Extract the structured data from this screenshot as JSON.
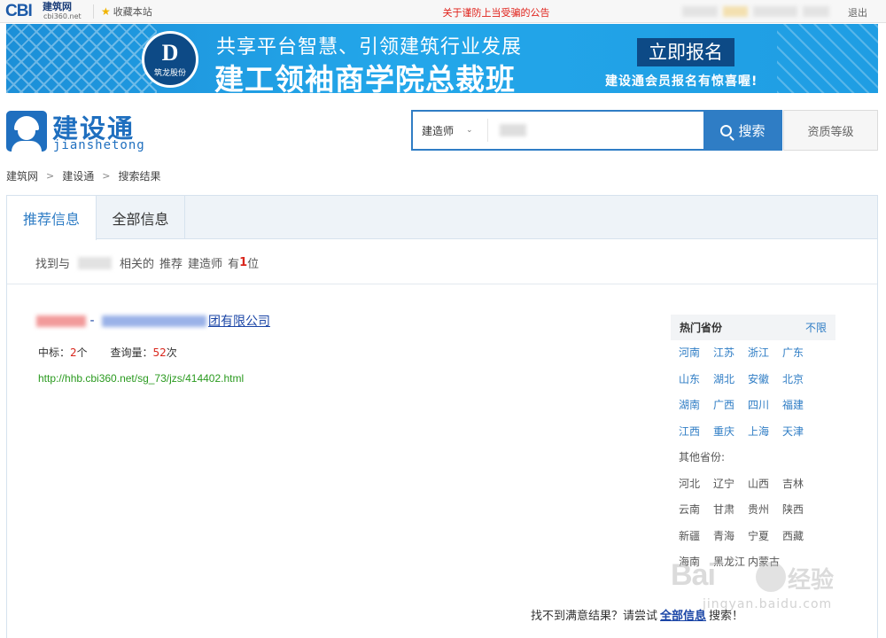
{
  "topbar": {
    "logo_text": "CBI",
    "logo_cn": "建筑网",
    "logo_domain": "cbi360.net",
    "favorite_label": "收藏本站",
    "notice": "关于谨防上当受骗的公告",
    "logout_label": "退出"
  },
  "banner": {
    "badge_brand": "筑龙股份",
    "line1": "共享平台智慧、引领建筑行业发展",
    "line2": "建工领袖商学院总裁班",
    "signup_label": "立即报名",
    "promo": "建设通会员报名有惊喜喔!"
  },
  "site_logo": {
    "title": "建设通",
    "pinyin": "jianshetong"
  },
  "search": {
    "category": "建造师",
    "query_value": "",
    "button_label": "搜索",
    "qualification_label": "资质等级"
  },
  "breadcrumb": [
    "建筑网",
    "建设通",
    "搜索结果"
  ],
  "tabs": [
    {
      "label": "推荐信息",
      "active": true
    },
    {
      "label": "全部信息",
      "active": false
    }
  ],
  "summary": {
    "prefix": "找到与",
    "middle": "相关的",
    "word1": "推荐",
    "word2": "建造师",
    "has": "有",
    "count": "1",
    "unit": "位"
  },
  "result": {
    "sep": " - ",
    "title_tail": "团有限公司",
    "bid_label": "中标：",
    "bid_count": "2",
    "bid_unit": "个",
    "views_label": "查询量：",
    "views_count": "52",
    "views_unit": "次",
    "url": "http://hhb.cbi360.net/sg_73/jzs/414402.html"
  },
  "provinces": {
    "hot_label": "热门省份",
    "unlimited_label": "不限",
    "hot": [
      "河南",
      "江苏",
      "浙江",
      "广东",
      "山东",
      "湖北",
      "安徽",
      "北京",
      "湖南",
      "广西",
      "四川",
      "福建",
      "江西",
      "重庆",
      "上海",
      "天津"
    ],
    "other_label": "其他省份:",
    "other": [
      "河北",
      "辽宁",
      "山西",
      "吉林",
      "云南",
      "甘肃",
      "贵州",
      "陕西",
      "新疆",
      "青海",
      "宁夏",
      "西藏",
      "海南",
      "黑龙江",
      "内蒙古"
    ]
  },
  "footer": {
    "prefix": "找不到满意结果？请尝试",
    "link": "全部信息",
    "suffix": "搜索！"
  },
  "watermark": {
    "brand": "Bai",
    "brand_cn": "经验",
    "domain": "jingyan.baidu.com"
  },
  "colors": {
    "accent": "#2f7dc5",
    "alert_red": "#d9261c",
    "url_green": "#2a9a1f",
    "link_blue": "#1a45a6"
  }
}
